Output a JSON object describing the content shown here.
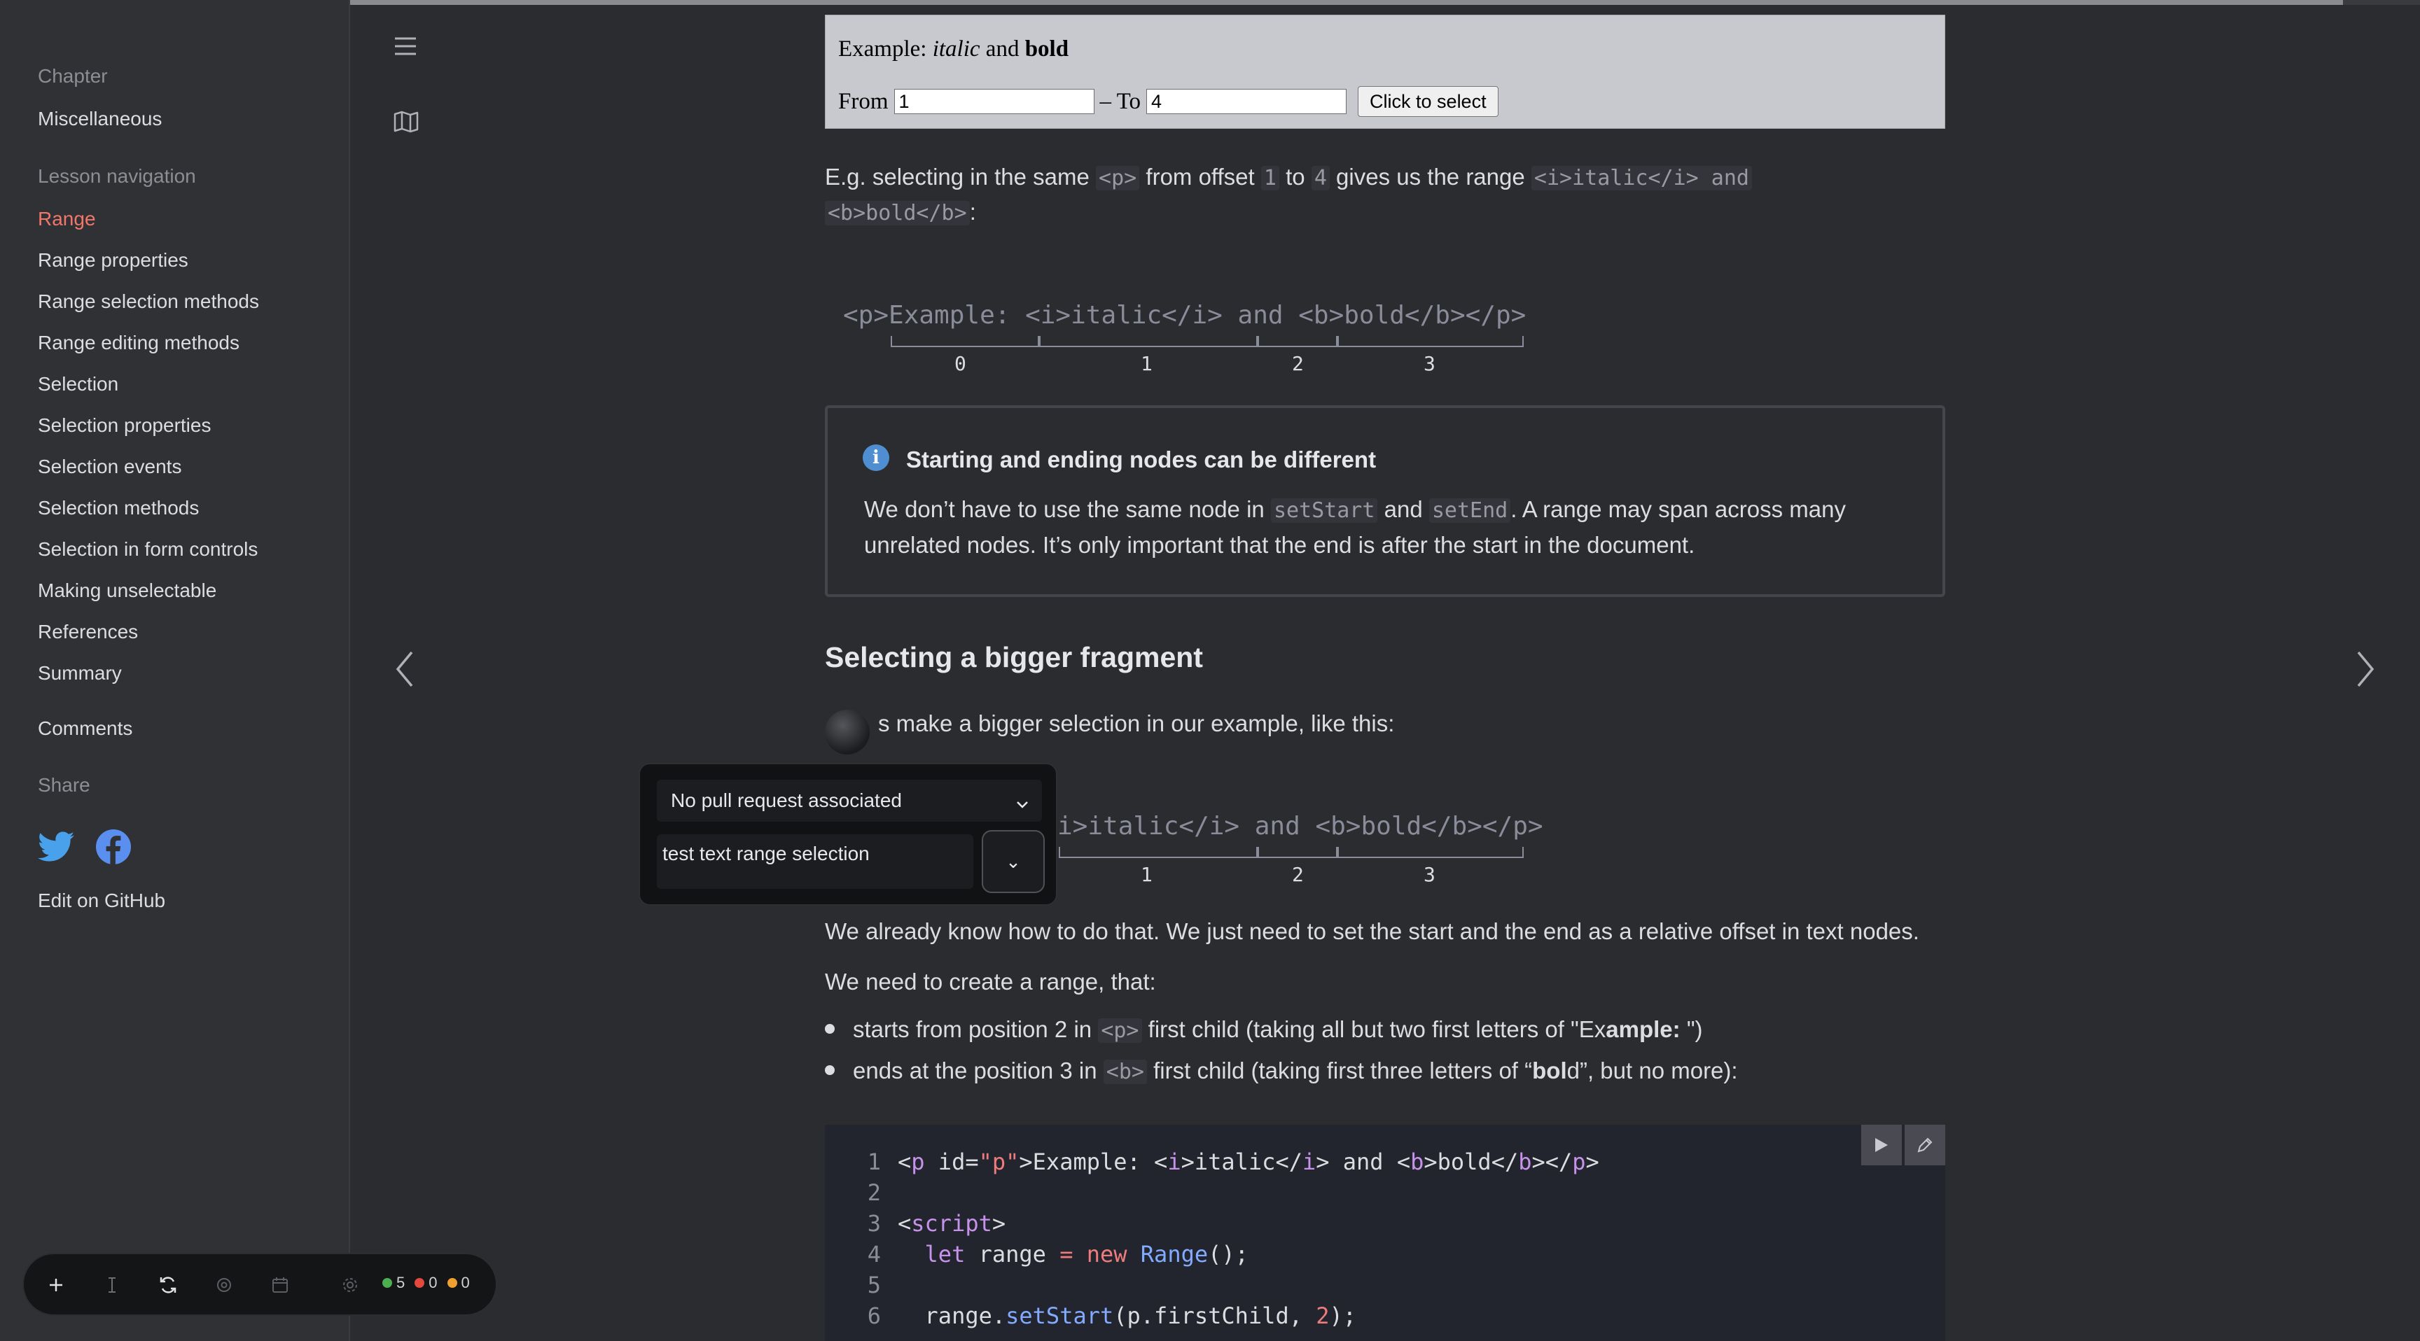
{
  "sidebar": {
    "chapter_label": "Chapter",
    "chapter_title": "Miscellaneous",
    "lesson_nav_label": "Lesson navigation",
    "items": [
      {
        "label": "Range"
      },
      {
        "label": "Range properties"
      },
      {
        "label": "Range selection methods"
      },
      {
        "label": "Range editing methods"
      },
      {
        "label": "Selection"
      },
      {
        "label": "Selection properties"
      },
      {
        "label": "Selection events"
      },
      {
        "label": "Selection methods"
      },
      {
        "label": "Selection in form controls"
      },
      {
        "label": "Making unselectable"
      },
      {
        "label": "References"
      },
      {
        "label": "Summary"
      }
    ],
    "comments": "Comments",
    "share_label": "Share",
    "edit_github": "Edit on GitHub",
    "accent_color": "#f0776a"
  },
  "demo": {
    "title_prefix": "Example:",
    "title_italic": "italic",
    "title_and": "and",
    "title_bold": "bold",
    "from_label": "From",
    "from_value": "1",
    "to_label": "– To",
    "to_value": "4",
    "button": "Click to select"
  },
  "para1": {
    "t1": "E.g. selecting in the same",
    "c1": "<p>",
    "t2": "from offset",
    "c2": "1",
    "t3": "to",
    "c3": "4",
    "t4": "gives us the range",
    "c4": "<i>italic</i> and",
    "c5": "<b>bold</b>",
    "t5": ":"
  },
  "diagram1": {
    "text": "<p>Example: <i>italic</i> and <b>bold</b></p>",
    "n0": "0",
    "n1": "1",
    "n2": "2",
    "n3": "3"
  },
  "notice": {
    "icon": "i",
    "title": "Starting and ending nodes can be different",
    "t1": "We don’t have to use the same node in",
    "c1": "setStart",
    "t2": "and",
    "c2": "setEnd",
    "t3": ". A range may span across many unrelated nodes. It’s only important that the end is after the start in the document."
  },
  "section2": {
    "heading": "Selecting a bigger fragment",
    "intro_visible": "s make a bigger selection in our example, like this:",
    "diagram_visible": "i>italic</i> and <b>bold</b></p>",
    "n1": "1",
    "n2": "2",
    "n3": "3",
    "p1": "We already know how to do that. We just need to set the start and the end as a relative offset in text nodes.",
    "p2": "We need to create a range, that:",
    "b1_t1": "starts from position 2 in",
    "b1_c": "<p>",
    "b1_t2": "first child (taking all but two first letters of \"Ex",
    "b1_bold": "ample:",
    "b1_t3": " \")",
    "b2_t1": "ends at the position 3 in",
    "b2_c": "<b>",
    "b2_t2": "first child (taking first three letters of “",
    "b2_bold": "bol",
    "b2_t3": "d”, but no more):"
  },
  "code": {
    "lines": [
      {
        "n": "1"
      },
      {
        "n": "2"
      },
      {
        "n": "3"
      },
      {
        "n": "4"
      },
      {
        "n": "5"
      },
      {
        "n": "6"
      }
    ],
    "l1": [
      "<",
      "p",
      " id",
      "=",
      "\"p\"",
      ">Example: <",
      "i",
      ">italic</",
      "i",
      "> and <",
      "b",
      ">bold</",
      "b",
      "></",
      "p",
      ">"
    ],
    "l3a": "<",
    "l3b": "script",
    "l3c": ">",
    "l4a": "  let",
    "l4b": " range ",
    "l4c": "=",
    "l4d": " new",
    "l4e": " Range",
    "l4f": "();",
    "l6a": "  range.",
    "l6b": "setStart",
    "l6c": "(p.firstChild, ",
    "l6d": "2",
    "l6e": ");"
  },
  "popup": {
    "select_value": "No pull request associated",
    "input_value": "test text range selection",
    "go_label": "⌄"
  },
  "toolbar": {
    "green_count": "5",
    "red_count": "0",
    "orange_count": "0",
    "green_color": "#4caf50",
    "red_color": "#e5483c",
    "orange_color": "#f0a030"
  }
}
